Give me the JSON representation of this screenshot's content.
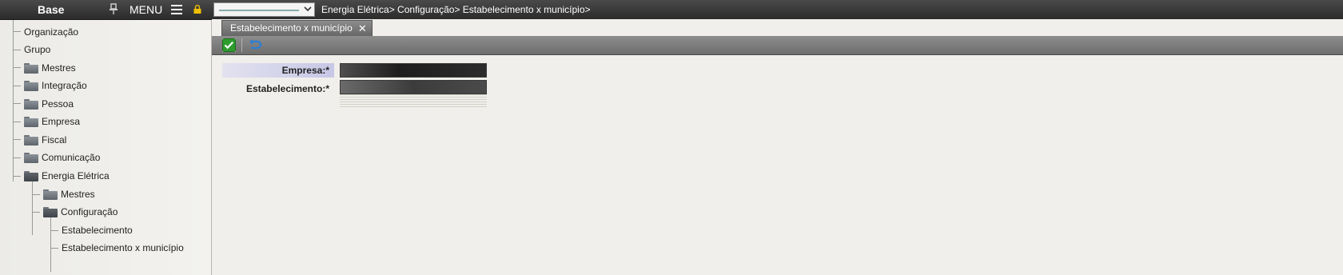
{
  "topbar": {
    "app_title": "Base",
    "menu_label": "MENU",
    "icons": [
      "pin-icon",
      "hamburger-icon",
      "lock-icon",
      "chevron-down-icon"
    ],
    "breadcrumb": "Energia Elétrica> Configuração> Estabelecimento x município>"
  },
  "sidebar": {
    "items": [
      {
        "label": "Organização"
      },
      {
        "label": "Grupo"
      },
      {
        "label": "Mestres"
      },
      {
        "label": "Integração"
      },
      {
        "label": "Pessoa"
      },
      {
        "label": "Empresa"
      },
      {
        "label": "Fiscal"
      },
      {
        "label": "Comunicação"
      },
      {
        "label": "Energia Elétrica"
      },
      {
        "label": "Mestres"
      },
      {
        "label": "Configuração"
      },
      {
        "label": "Estabelecimento"
      },
      {
        "label": "Estabelecimento x município"
      }
    ]
  },
  "tab": {
    "label": "Estabelecimento x município",
    "close": "✕"
  },
  "toolbar": {
    "icons": [
      "confirm-check-icon",
      "undo-icon"
    ]
  },
  "form": {
    "empresa_label": "Empresa:*",
    "estabelecimento_label": "Estabelecimento:*"
  },
  "colors": {
    "topbar": "#2b2b2b",
    "accent_lock": "#f0c000",
    "confirm_green": "#2e9b2e",
    "undo_blue": "#2f7fd0",
    "label_highlight": "#c7c7e6"
  }
}
